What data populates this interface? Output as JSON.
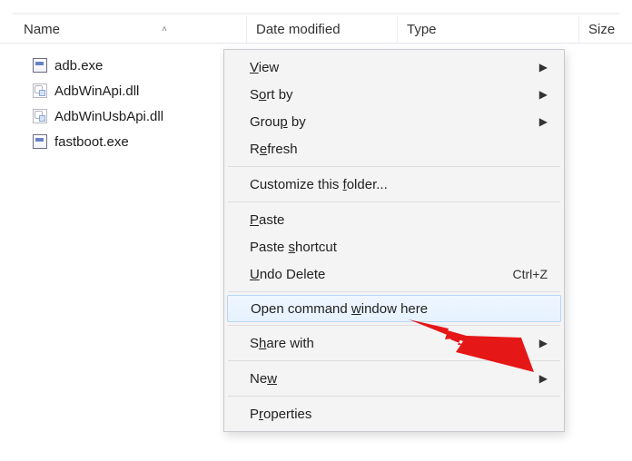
{
  "columns": {
    "name": "Name",
    "date": "Date modified",
    "type": "Type",
    "size": "Size"
  },
  "files": [
    {
      "icon": "exe",
      "name": "adb.exe"
    },
    {
      "icon": "dll",
      "name": "AdbWinApi.dll"
    },
    {
      "icon": "dll",
      "name": "AdbWinUsbApi.dll"
    },
    {
      "icon": "exe",
      "name": "fastboot.exe"
    }
  ],
  "menu": {
    "view": "View",
    "sort_by": "Sort by",
    "group_by": "Group by",
    "refresh": "Refresh",
    "customize": "Customize this folder...",
    "paste": "Paste",
    "paste_shortcut": "Paste shortcut",
    "undo_delete": "Undo Delete",
    "undo_delete_shortcut": "Ctrl+Z",
    "open_cmd": "Open command window here",
    "share_with": "Share with",
    "new": "New",
    "properties": "Properties"
  },
  "annotation": {
    "arrow_color": "#e61717"
  }
}
